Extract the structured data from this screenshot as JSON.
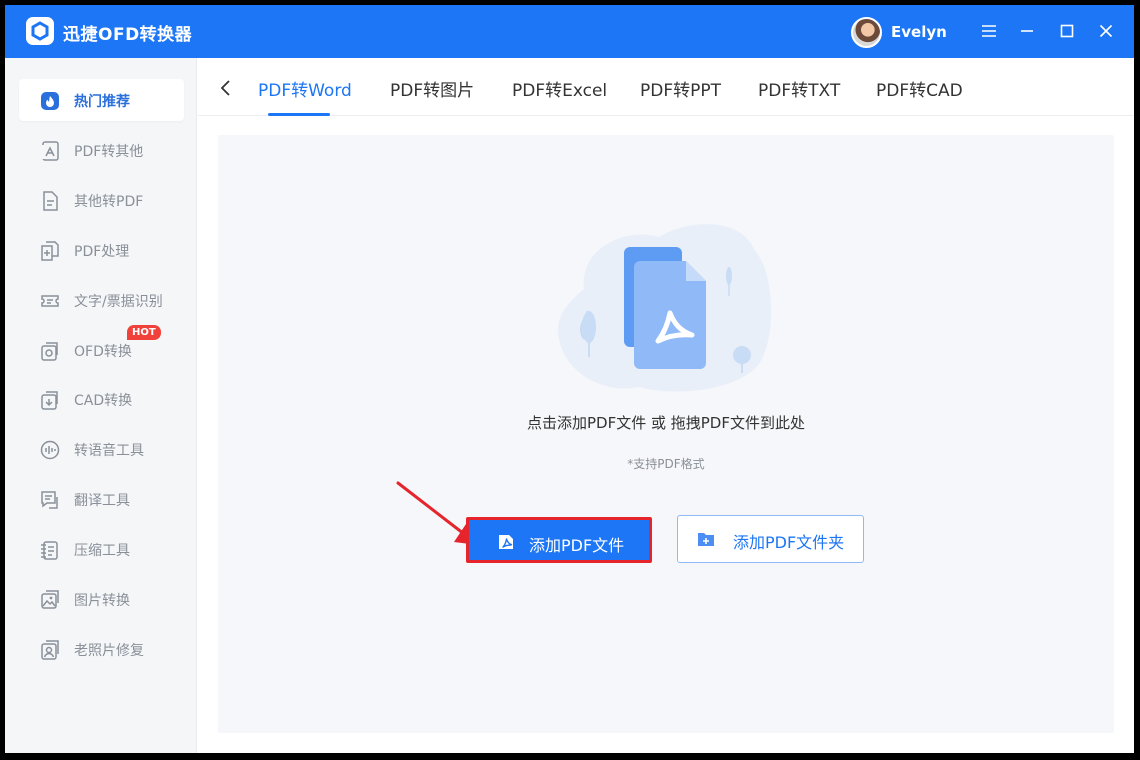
{
  "app": {
    "title": "迅捷OFD转换器",
    "user": "Evelyn",
    "accent_color": "#1c76f5"
  },
  "window_controls": [
    "menu-icon",
    "minimize-icon",
    "maximize-icon",
    "close-icon"
  ],
  "sidebar": {
    "items": [
      {
        "label": "热门推荐",
        "icon": "hot-recommend-icon",
        "active": true
      },
      {
        "label": "PDF转其他",
        "icon": "pdf-convert-icon"
      },
      {
        "label": "其他转PDF",
        "icon": "to-pdf-icon"
      },
      {
        "label": "PDF处理",
        "icon": "pdf-process-icon"
      },
      {
        "label": "文字/票据识别",
        "icon": "ocr-icon"
      },
      {
        "label": "OFD转换",
        "icon": "ofd-icon",
        "badge": "HOT"
      },
      {
        "label": "CAD转换",
        "icon": "cad-icon"
      },
      {
        "label": "转语音工具",
        "icon": "voice-icon"
      },
      {
        "label": "翻译工具",
        "icon": "translate-icon"
      },
      {
        "label": "压缩工具",
        "icon": "compress-icon"
      },
      {
        "label": "图片转换",
        "icon": "image-icon"
      },
      {
        "label": "老照片修复",
        "icon": "photo-restore-icon"
      }
    ]
  },
  "tabs": {
    "items": [
      {
        "label": "PDF转Word",
        "active": true
      },
      {
        "label": "PDF转图片"
      },
      {
        "label": "PDF转Excel"
      },
      {
        "label": "PDF转PPT"
      },
      {
        "label": "PDF转TXT"
      },
      {
        "label": "PDF转CAD"
      }
    ]
  },
  "dropzone": {
    "hint": "点击添加PDF文件 或 拖拽PDF文件到此处",
    "format": "*支持PDF格式",
    "add_file_label": "添加PDF文件",
    "add_folder_label": "添加PDF文件夹"
  }
}
